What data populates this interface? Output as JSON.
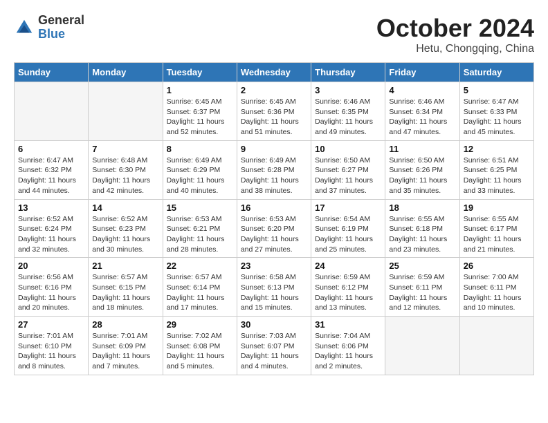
{
  "header": {
    "logo_line1": "General",
    "logo_line2": "Blue",
    "month": "October 2024",
    "location": "Hetu, Chongqing, China"
  },
  "weekdays": [
    "Sunday",
    "Monday",
    "Tuesday",
    "Wednesday",
    "Thursday",
    "Friday",
    "Saturday"
  ],
  "weeks": [
    [
      {
        "day": "",
        "info": ""
      },
      {
        "day": "",
        "info": ""
      },
      {
        "day": "1",
        "info": "Sunrise: 6:45 AM\nSunset: 6:37 PM\nDaylight: 11 hours and 52 minutes."
      },
      {
        "day": "2",
        "info": "Sunrise: 6:45 AM\nSunset: 6:36 PM\nDaylight: 11 hours and 51 minutes."
      },
      {
        "day": "3",
        "info": "Sunrise: 6:46 AM\nSunset: 6:35 PM\nDaylight: 11 hours and 49 minutes."
      },
      {
        "day": "4",
        "info": "Sunrise: 6:46 AM\nSunset: 6:34 PM\nDaylight: 11 hours and 47 minutes."
      },
      {
        "day": "5",
        "info": "Sunrise: 6:47 AM\nSunset: 6:33 PM\nDaylight: 11 hours and 45 minutes."
      }
    ],
    [
      {
        "day": "6",
        "info": "Sunrise: 6:47 AM\nSunset: 6:32 PM\nDaylight: 11 hours and 44 minutes."
      },
      {
        "day": "7",
        "info": "Sunrise: 6:48 AM\nSunset: 6:30 PM\nDaylight: 11 hours and 42 minutes."
      },
      {
        "day": "8",
        "info": "Sunrise: 6:49 AM\nSunset: 6:29 PM\nDaylight: 11 hours and 40 minutes."
      },
      {
        "day": "9",
        "info": "Sunrise: 6:49 AM\nSunset: 6:28 PM\nDaylight: 11 hours and 38 minutes."
      },
      {
        "day": "10",
        "info": "Sunrise: 6:50 AM\nSunset: 6:27 PM\nDaylight: 11 hours and 37 minutes."
      },
      {
        "day": "11",
        "info": "Sunrise: 6:50 AM\nSunset: 6:26 PM\nDaylight: 11 hours and 35 minutes."
      },
      {
        "day": "12",
        "info": "Sunrise: 6:51 AM\nSunset: 6:25 PM\nDaylight: 11 hours and 33 minutes."
      }
    ],
    [
      {
        "day": "13",
        "info": "Sunrise: 6:52 AM\nSunset: 6:24 PM\nDaylight: 11 hours and 32 minutes."
      },
      {
        "day": "14",
        "info": "Sunrise: 6:52 AM\nSunset: 6:23 PM\nDaylight: 11 hours and 30 minutes."
      },
      {
        "day": "15",
        "info": "Sunrise: 6:53 AM\nSunset: 6:21 PM\nDaylight: 11 hours and 28 minutes."
      },
      {
        "day": "16",
        "info": "Sunrise: 6:53 AM\nSunset: 6:20 PM\nDaylight: 11 hours and 27 minutes."
      },
      {
        "day": "17",
        "info": "Sunrise: 6:54 AM\nSunset: 6:19 PM\nDaylight: 11 hours and 25 minutes."
      },
      {
        "day": "18",
        "info": "Sunrise: 6:55 AM\nSunset: 6:18 PM\nDaylight: 11 hours and 23 minutes."
      },
      {
        "day": "19",
        "info": "Sunrise: 6:55 AM\nSunset: 6:17 PM\nDaylight: 11 hours and 21 minutes."
      }
    ],
    [
      {
        "day": "20",
        "info": "Sunrise: 6:56 AM\nSunset: 6:16 PM\nDaylight: 11 hours and 20 minutes."
      },
      {
        "day": "21",
        "info": "Sunrise: 6:57 AM\nSunset: 6:15 PM\nDaylight: 11 hours and 18 minutes."
      },
      {
        "day": "22",
        "info": "Sunrise: 6:57 AM\nSunset: 6:14 PM\nDaylight: 11 hours and 17 minutes."
      },
      {
        "day": "23",
        "info": "Sunrise: 6:58 AM\nSunset: 6:13 PM\nDaylight: 11 hours and 15 minutes."
      },
      {
        "day": "24",
        "info": "Sunrise: 6:59 AM\nSunset: 6:12 PM\nDaylight: 11 hours and 13 minutes."
      },
      {
        "day": "25",
        "info": "Sunrise: 6:59 AM\nSunset: 6:11 PM\nDaylight: 11 hours and 12 minutes."
      },
      {
        "day": "26",
        "info": "Sunrise: 7:00 AM\nSunset: 6:11 PM\nDaylight: 11 hours and 10 minutes."
      }
    ],
    [
      {
        "day": "27",
        "info": "Sunrise: 7:01 AM\nSunset: 6:10 PM\nDaylight: 11 hours and 8 minutes."
      },
      {
        "day": "28",
        "info": "Sunrise: 7:01 AM\nSunset: 6:09 PM\nDaylight: 11 hours and 7 minutes."
      },
      {
        "day": "29",
        "info": "Sunrise: 7:02 AM\nSunset: 6:08 PM\nDaylight: 11 hours and 5 minutes."
      },
      {
        "day": "30",
        "info": "Sunrise: 7:03 AM\nSunset: 6:07 PM\nDaylight: 11 hours and 4 minutes."
      },
      {
        "day": "31",
        "info": "Sunrise: 7:04 AM\nSunset: 6:06 PM\nDaylight: 11 hours and 2 minutes."
      },
      {
        "day": "",
        "info": ""
      },
      {
        "day": "",
        "info": ""
      }
    ]
  ]
}
